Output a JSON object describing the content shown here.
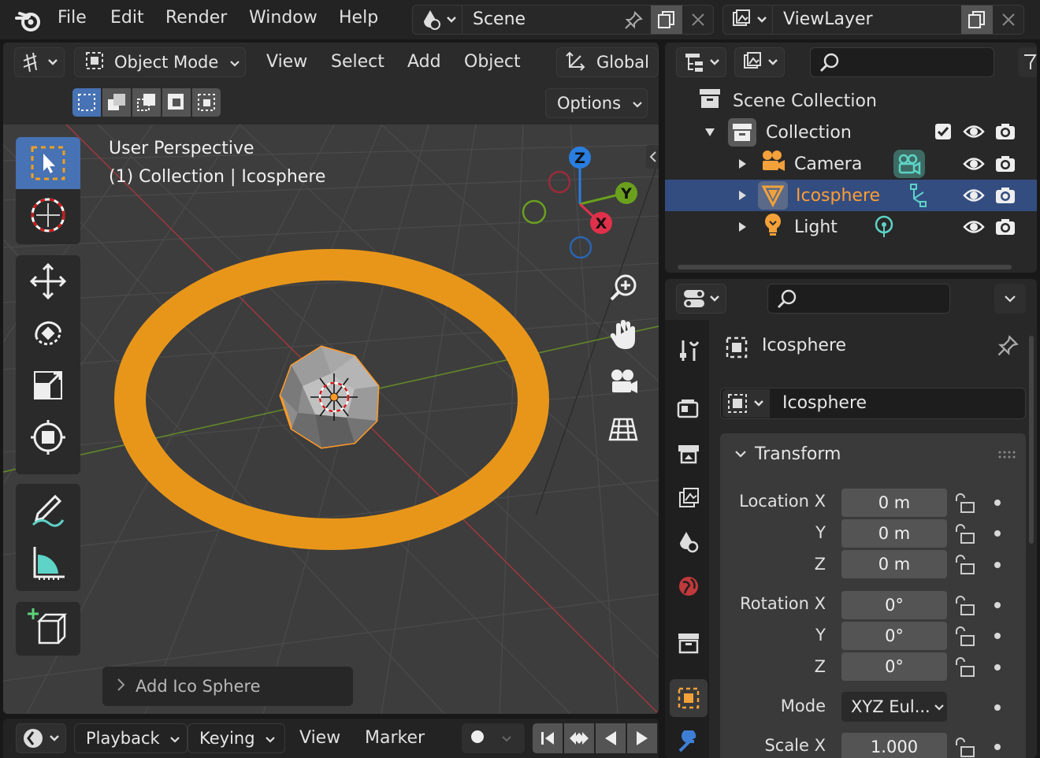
{
  "topbar": {
    "menus": [
      "File",
      "Edit",
      "Render",
      "Window",
      "Help"
    ],
    "scene_label": "Scene",
    "viewlayer_label": "ViewLayer"
  },
  "viewport_header": {
    "mode": "Object Mode",
    "menus": [
      "View",
      "Select",
      "Add",
      "Object"
    ],
    "orientation": "Global",
    "options": "Options"
  },
  "viewport": {
    "perspective": "User Perspective",
    "context": "(1) Collection | Icosphere",
    "last_operator": "Add Ico Sphere",
    "gizmo_axes": {
      "x": "X",
      "y": "Y",
      "z": "Z"
    },
    "colors": {
      "selection": "#f0a020",
      "x_axis": "#c8384a",
      "y_axis": "#6aa01e",
      "grid_bg": "#3d3d3d"
    }
  },
  "outliner": {
    "scene_collection": "Scene Collection",
    "items": [
      {
        "label": "Collection",
        "type": "collection"
      },
      {
        "label": "Camera",
        "type": "camera"
      },
      {
        "label": "Icosphere",
        "type": "mesh",
        "selected": true
      },
      {
        "label": "Light",
        "type": "light"
      }
    ],
    "colors": {
      "selected_row": "#334d80",
      "active_text": "#ff9d33"
    }
  },
  "properties": {
    "object_name": "Icosphere",
    "datablock_name": "Icosphere",
    "panel_title": "Transform",
    "fields": [
      {
        "label": "Location X",
        "value": "0 m"
      },
      {
        "label": "Y",
        "value": "0 m"
      },
      {
        "label": "Z",
        "value": "0 m"
      },
      {
        "label": "Rotation X",
        "value": "0°"
      },
      {
        "label": "Y",
        "value": "0°"
      },
      {
        "label": "Z",
        "value": "0°"
      },
      {
        "label": "Mode",
        "value": "XYZ Eul..."
      },
      {
        "label": "Scale X",
        "value": "1.000"
      }
    ]
  },
  "timeline": {
    "menus": [
      "Playback",
      "Keying",
      "View",
      "Marker"
    ]
  }
}
